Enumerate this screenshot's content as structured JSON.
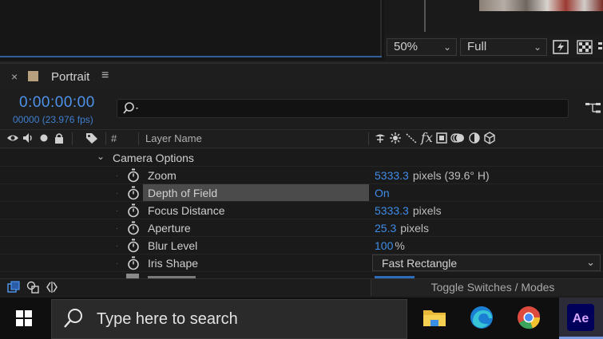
{
  "viewer": {
    "zoom": {
      "value": "50%",
      "options_visible": [
        "50%"
      ]
    },
    "resolution": {
      "value": "Full"
    },
    "icons": [
      "fast-preview-icon",
      "transparency-grid-icon",
      "more-icon"
    ]
  },
  "panel": {
    "close_glyph": "×",
    "title": "Portrait",
    "menu_glyph": "≡",
    "swatch_color": "#b8a07e"
  },
  "timeline": {
    "timecode": "0:00:00:00",
    "frames": "00000 (23.976 fps)",
    "search_placeholder": "",
    "accent": "#4e93ea"
  },
  "columns": {
    "hash": "#",
    "layer_name": "Layer Name",
    "left_icons": [
      "eye-icon",
      "audio-icon",
      "solo-icon",
      "lock-icon",
      "label-tag-icon"
    ],
    "switch_icons": [
      "shy-icon",
      "collapse-icon",
      "quality-icon",
      "effects-icon",
      "frame-blend-icon",
      "motion-blur-icon",
      "adjustment-icon",
      "3d-layer-icon"
    ],
    "fx_label": "fx"
  },
  "layers": {
    "group": {
      "name": "Camera Options",
      "expanded": true
    },
    "properties": [
      {
        "name": "Zoom",
        "value": "5333.3",
        "unit": "pixels (39.6° H)"
      },
      {
        "name": "Depth of Field",
        "value": "On",
        "unit": "",
        "selected": true
      },
      {
        "name": "Focus Distance",
        "value": "5333.3",
        "unit": "pixels"
      },
      {
        "name": "Aperture",
        "value": "25.3",
        "unit": "pixels"
      },
      {
        "name": "Blur Level",
        "value": "100",
        "unit": "%"
      },
      {
        "name": "Iris Shape",
        "dropdown": "Fast Rectangle"
      }
    ]
  },
  "status": {
    "toggle_label": "Toggle Switches / Modes"
  },
  "taskbar": {
    "search_text": "Type here to search",
    "apps": [
      "file-explorer-icon",
      "edge-icon",
      "chrome-icon",
      "after-effects-icon"
    ],
    "ae_label": "Ae"
  }
}
